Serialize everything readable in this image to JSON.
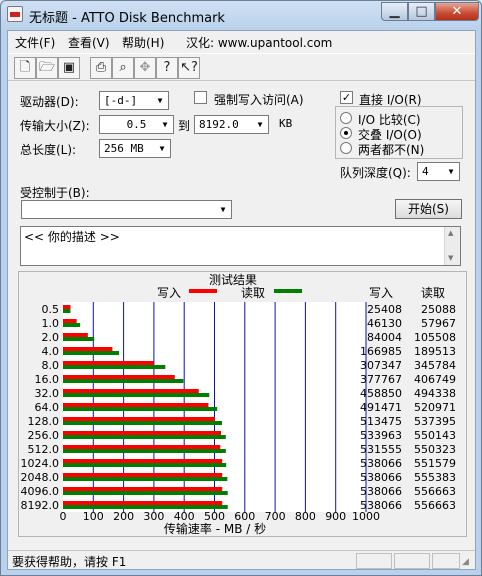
{
  "window": {
    "title": "无标题 - ATTO Disk Benchmark"
  },
  "menu": {
    "file": "文件(F)",
    "view": "查看(V)",
    "help": "帮助(H)",
    "localize": "汉化: www.upantool.com"
  },
  "toolbar": {
    "icons": [
      "new-doc-icon",
      "open-folder-icon",
      "save-icon",
      "print-icon",
      "print-preview-icon",
      "move-icon",
      "help-icon",
      "context-help-icon"
    ]
  },
  "controls": {
    "drive_label": "驱动器(D):",
    "drive_value": "[-d-]",
    "transfer_label": "传输大小(Z):",
    "transfer_from": "0.5",
    "transfer_to_label": "到",
    "transfer_to": "8192.0",
    "transfer_unit": "KB",
    "total_label": "总长度(L):",
    "total_value": "256 MB",
    "force_write_label": "强制写入访问(A)",
    "force_write_checked": false,
    "direct_io_label": "直接 I/O(R)",
    "direct_io_checked": true,
    "io_compare_label": "I/O 比较(C)",
    "overlap_io_label": "交叠 I/O(O)",
    "neither_label": "两者都不(N)",
    "selected_io_mode": "overlap_io",
    "queue_label": "队列深度(Q):",
    "queue_value": "4",
    "controlled_by_label": "受控制于(B):",
    "controlled_by_value": "",
    "start_button": "开始(S)",
    "description": "<<  你的描述   >>"
  },
  "chart_data": {
    "type": "bar",
    "title": "测试结果",
    "legend": [
      {
        "name": "写入",
        "color": "#ff0000"
      },
      {
        "name": "读取",
        "color": "#008000"
      }
    ],
    "xlabel": "传输速率 - MB / 秒",
    "xlim": [
      0,
      1000
    ],
    "xticks": [
      0,
      100,
      200,
      300,
      400,
      500,
      600,
      700,
      800,
      900,
      1000
    ],
    "grid": true,
    "write_header": "写入",
    "read_header": "读取",
    "categories": [
      "0.5",
      "1.0",
      "2.0",
      "4.0",
      "8.0",
      "16.0",
      "32.0",
      "64.0",
      "128.0",
      "256.0",
      "512.0",
      "1024.0",
      "2048.0",
      "4096.0",
      "8192.0"
    ],
    "series": [
      {
        "name": "写入",
        "color": "#ff0000",
        "values": [
          25408,
          46130,
          84004,
          166985,
          307347,
          377767,
          458850,
          491471,
          513475,
          533963,
          531555,
          538066,
          538066,
          538066,
          538066
        ]
      },
      {
        "name": "读取",
        "color": "#008000",
        "values": [
          25088,
          57967,
          105508,
          189513,
          345784,
          406749,
          494338,
          520971,
          537395,
          550143,
          550323,
          551579,
          555383,
          556663,
          556663
        ]
      }
    ]
  },
  "status": {
    "text": "要获得帮助，请按 F1"
  }
}
